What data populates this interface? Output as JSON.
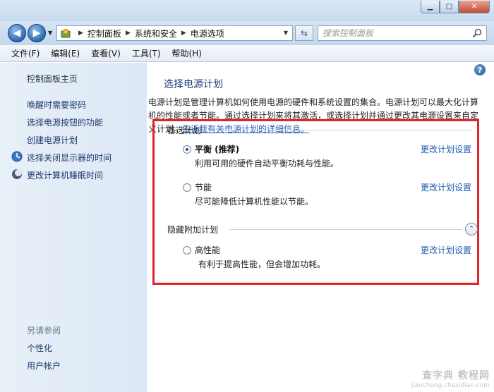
{
  "window": {
    "minimize": "▁",
    "maximize": "□",
    "close": "✕"
  },
  "address": {
    "breadcrumb": [
      "控制面板",
      "系统和安全",
      "电源选项"
    ],
    "search_placeholder": "搜索控制面板"
  },
  "menubar": {
    "items": [
      "文件(F)",
      "编辑(E)",
      "查看(V)",
      "工具(T)",
      "帮助(H)"
    ]
  },
  "sidebar": {
    "home": "控制面板主页",
    "items": [
      {
        "label": "唤醒时需要密码"
      },
      {
        "label": "选择电源按钮的功能"
      },
      {
        "label": "创建电源计划"
      },
      {
        "label": "选择关闭显示器的时间",
        "icon": "monitor-icon"
      },
      {
        "label": "更改计算机睡眠时间",
        "icon": "moon-icon"
      }
    ],
    "see_also": "另请参阅",
    "see_also_items": [
      "个性化",
      "用户帐户"
    ]
  },
  "content": {
    "title": "选择电源计划",
    "intro_text": "电源计划是管理计算机如何使用电源的硬件和系统设置的集合。电源计划可以最大化计算机的性能或者节能。通过选择计划来将其激活，或选择计划并通过更改其电源设置来自定义计划。",
    "intro_link": "告诉我有关电源计划的详细信息。",
    "preferred_heading": "首选计划",
    "hidden_heading": "隐藏附加计划",
    "plans": [
      {
        "name": "平衡 (推荐)",
        "desc": "利用可用的硬件自动平衡功耗与性能。",
        "link": "更改计划设置",
        "checked": true
      },
      {
        "name": "节能",
        "desc": "尽可能降低计算机性能以节能。",
        "link": "更改计划设置",
        "checked": false
      },
      {
        "name": "高性能",
        "desc": "有利于提高性能，但会增加功耗。",
        "link": "更改计划设置",
        "checked": false
      }
    ]
  },
  "watermark": {
    "big": "查字典 教程网",
    "small": "jiaocheng.chazidian.com"
  },
  "colors": {
    "highlight": "#e0242a",
    "link": "#1f5fb0"
  }
}
